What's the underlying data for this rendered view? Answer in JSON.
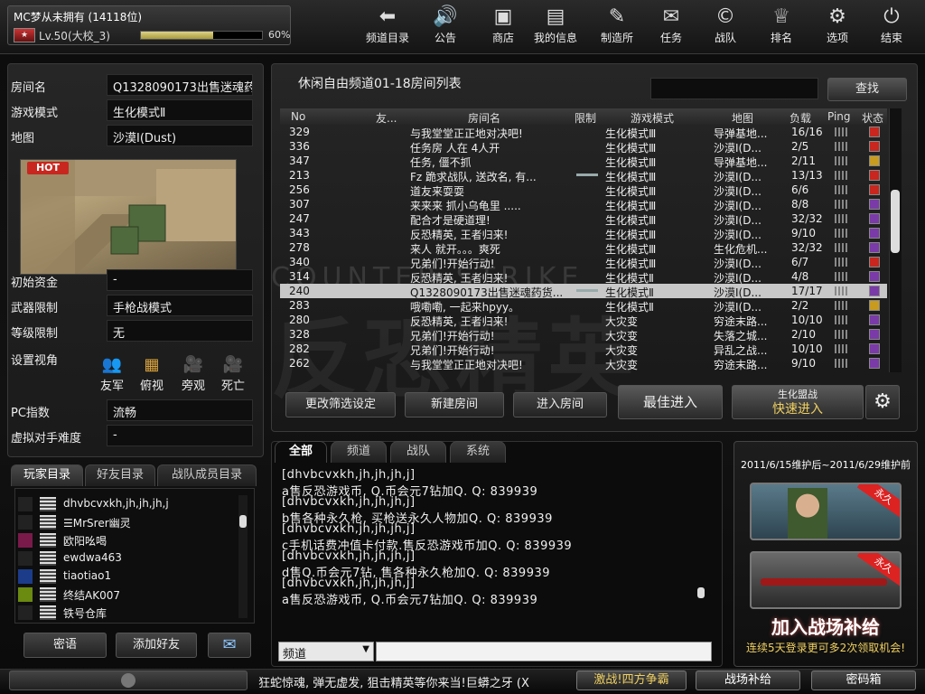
{
  "user": {
    "name": "MC梦从未拥有 (14118位)",
    "level": "Lv.50(大校_3)",
    "exp_percent": "60%",
    "exp_fraction": 0.6
  },
  "topnav": [
    {
      "label": "频道目录",
      "icon": "back-arrow-icon",
      "glyph": "⬅"
    },
    {
      "label": "公告",
      "icon": "speaker-icon",
      "glyph": "🔊"
    },
    {
      "label": "商店",
      "icon": "shop-icon",
      "glyph": "▣"
    },
    {
      "label": "我的信息",
      "icon": "id-card-icon",
      "glyph": "▤"
    },
    {
      "label": "制造所",
      "icon": "gun-icon",
      "glyph": "✎"
    },
    {
      "label": "任务",
      "icon": "task-icon",
      "glyph": "✉"
    },
    {
      "label": "战队",
      "icon": "clan-icon",
      "glyph": "©"
    },
    {
      "label": "排名",
      "icon": "trophy-icon",
      "glyph": "♕"
    },
    {
      "label": "选项",
      "icon": "gear-icon",
      "glyph": "⚙"
    },
    {
      "label": "结束",
      "icon": "power-icon",
      "glyph": "⏻"
    }
  ],
  "room_info": {
    "room_name_label": "房间名",
    "room_name": "Q1328090173出售迷魂药货到付款",
    "mode_label": "游戏模式",
    "mode": "生化模式Ⅱ",
    "map_label": "地图",
    "map": "沙漠Ⅰ(Dust)",
    "hot": "HOT",
    "funds_label": "初始资金",
    "funds": "-",
    "weapon_label": "武器限制",
    "weapon": "手枪战模式",
    "level_label": "等级限制",
    "level": "无",
    "view_label": "设置视角",
    "views": [
      {
        "label": "友军",
        "icon": "ally-view-icon",
        "glyph": "👥"
      },
      {
        "label": "俯视",
        "icon": "top-view-icon",
        "glyph": "▦"
      },
      {
        "label": "旁观",
        "icon": "spectate-icon",
        "glyph": "🎥"
      },
      {
        "label": "死亡",
        "icon": "death-cam-icon",
        "glyph": "🎥"
      }
    ],
    "pc_label": "PC指数",
    "pc": "流畅",
    "ai_label": "虚拟对手难度",
    "ai": "-"
  },
  "player_tabs": [
    "玩家目录",
    "好友目录",
    "战队成员目录"
  ],
  "players": [
    {
      "name": "dhvbcvxkh,jh,jh,jh,j",
      "badge_color": "#222222"
    },
    {
      "name": "☰MrSrer幽灵",
      "badge_color": "#222222"
    },
    {
      "name": "欧阳吆喝",
      "badge_color": "#7a1a4a"
    },
    {
      "name": "ewdwa463",
      "badge_color": "#222222"
    },
    {
      "name": "tiaotiao1",
      "badge_color": "#1c3c8a"
    },
    {
      "name": "终结AK007",
      "badge_color": "#6a8a10"
    },
    {
      "name": "铁号仓库",
      "badge_color": "#222222"
    }
  ],
  "player_buttons": {
    "whisper": "密语",
    "add_friend": "添加好友"
  },
  "room_list": {
    "title": "休闲自由频道01-18房间列表",
    "search": "查找",
    "headers": [
      "No",
      "友...",
      "房间名",
      "限制",
      "游戏模式",
      "地图",
      "负载",
      "Ping",
      "状态"
    ],
    "rows": [
      {
        "no": "329",
        "name": "与我堂堂正正地对决吧!",
        "mode": "生化模式Ⅲ",
        "map": "导弹基地...",
        "load": "16/16",
        "status": "red"
      },
      {
        "no": "336",
        "name": "任务房 人在 4人开",
        "mode": "生化模式Ⅲ",
        "map": "沙漠Ⅰ(D...",
        "load": "2/5",
        "status": "red"
      },
      {
        "no": "347",
        "name": "任务, 僵不抓",
        "mode": "生化模式Ⅲ",
        "map": "导弹基地...",
        "load": "2/11",
        "status": "pause"
      },
      {
        "no": "213",
        "name": "Fz 跪求战队, 送改名, 有...",
        "mode": "生化模式Ⅲ",
        "map": "沙漠Ⅰ(D...",
        "load": "13/13",
        "status": "red",
        "limit": true
      },
      {
        "no": "256",
        "name": "道友来耍耍",
        "mode": "生化模式Ⅲ",
        "map": "沙漠Ⅰ(D...",
        "load": "6/6",
        "status": "red"
      },
      {
        "no": "307",
        "name": "来来来  抓小乌龟里   .....",
        "mode": "生化模式Ⅲ",
        "map": "沙漠Ⅰ(D...",
        "load": "8/8",
        "status": "purple"
      },
      {
        "no": "247",
        "name": "配合才是硬道理!",
        "mode": "生化模式Ⅲ",
        "map": "沙漠Ⅰ(D...",
        "load": "32/32",
        "status": "purple"
      },
      {
        "no": "343",
        "name": "反恐精英, 王者归来!",
        "mode": "生化模式Ⅲ",
        "map": "沙漠Ⅰ(D...",
        "load": "9/10",
        "status": "purple"
      },
      {
        "no": "278",
        "name": "来人    就开。。。爽死",
        "mode": "生化模式Ⅲ",
        "map": "生化危机...",
        "load": "32/32",
        "status": "purple"
      },
      {
        "no": "340",
        "name": "兄弟们!开始行动!",
        "mode": "生化模式Ⅲ",
        "map": "沙漠Ⅰ(D...",
        "load": "6/7",
        "status": "red"
      },
      {
        "no": "314",
        "name": "反恐精英, 王者归来!",
        "mode": "生化模式Ⅱ",
        "map": "沙漠Ⅰ(D...",
        "load": "4/8",
        "status": "purple"
      },
      {
        "no": "240",
        "name": "Q1328090173出售迷魂药货...",
        "mode": "生化模式Ⅱ",
        "map": "沙漠Ⅰ(D...",
        "load": "17/17",
        "status": "purple",
        "limit": true,
        "selected": true
      },
      {
        "no": "283",
        "name": "哦嘞嘞,  一起来hpyy。",
        "mode": "生化模式Ⅱ",
        "map": "沙漠Ⅰ(D...",
        "load": "2/2",
        "status": "pause"
      },
      {
        "no": "280",
        "name": "反恐精英, 王者归来!",
        "mode": "大灾变",
        "map": "穷途末路...",
        "load": "10/10",
        "status": "purple"
      },
      {
        "no": "328",
        "name": "兄弟们!开始行动!",
        "mode": "大灾变",
        "map": "失落之城...",
        "load": "2/10",
        "status": "purple"
      },
      {
        "no": "282",
        "name": "兄弟们!开始行动!",
        "mode": "大灾变",
        "map": "异乱之战...",
        "load": "10/10",
        "status": "purple"
      },
      {
        "no": "262",
        "name": "与我堂堂正正地对决吧!",
        "mode": "大灾变",
        "map": "穷途末路...",
        "load": "9/10",
        "status": "purple"
      }
    ],
    "buttons": {
      "filter": "更改筛选设定",
      "create": "新建房间",
      "enter": "进入房间",
      "best": "最佳进入",
      "quick_top": "生化盟战",
      "quick": "快速进入"
    },
    "watermark": "反恐精英",
    "watermark2": "COUNTER-STRIKE"
  },
  "chat": {
    "tabs": [
      "全部",
      "频道",
      "战队",
      "系统"
    ],
    "lines": [
      "[dhvbcvxkh,jh,jh,jh,j]",
      "a售反恐游戏币, Q.币会元7钻加Q. Q: 839939",
      "[dhvbcvxkh,jh,jh,jh,j]",
      "b售各种永久枪, 买枪送永久人物加Q. Q: 839939",
      "[dhvbcvxkh,jh,jh,jh,j]",
      "c手机话费冲值卡付款.售反恐游戏币加Q. Q: 839939",
      "[dhvbcvxkh,jh,jh,jh,j]",
      "d售Q.币会元7钻, 售各种永久枪加Q. Q: 839939",
      "[dhvbcvxkh,jh,jh,jh,j]",
      "a售反恐游戏币, Q.币会元7钻加Q. Q: 839939"
    ],
    "channel": "频道"
  },
  "ad": {
    "date": "2011/6/15维护后~2011/6/29维护前",
    "badge": "永久",
    "title": "加入战场补给",
    "subtitle": "连续5天登录更可多2次领取机会!"
  },
  "bottom": {
    "ticker": "狂蛇惊魂, 弹无虚发, 狙击精英等你来当!巨蟒之牙 (X",
    "btn1": "激战!四方争霸",
    "btn2": "战场补给",
    "btn3": "密码箱"
  },
  "colors": {
    "status_red": "#c8261e",
    "status_purple": "#7a3aa8",
    "status_pause": "#c89a1e",
    "accent_gold": "#f0d060"
  }
}
